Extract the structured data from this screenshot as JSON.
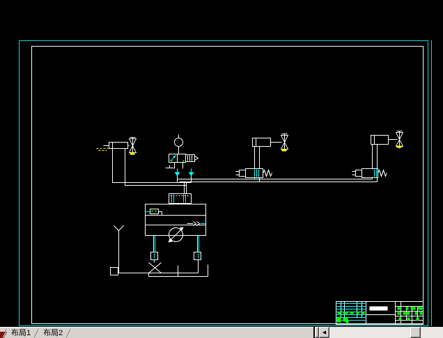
{
  "window": {
    "app_type": "cad-layout-view",
    "background": "#000000"
  },
  "colors": {
    "viewport_border": "#00dede",
    "frame_white": "#ffffff",
    "line_white": "#ffffff",
    "accent_cyan": "#00ffff",
    "accent_yellow": "#ffff00",
    "accent_green": "#00ff00",
    "chrome_gray": "#d6d3ce",
    "corner_red": "#7e1410"
  },
  "tab_bar": {
    "tabs": [
      {
        "label": "布局1",
        "active": true
      },
      {
        "label": "布局2",
        "active": false
      }
    ]
  },
  "scrollbar": {
    "left_arrow_icon": "◀"
  }
}
